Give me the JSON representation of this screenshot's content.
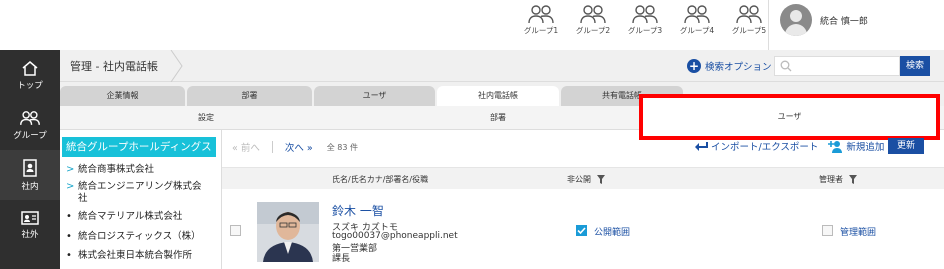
{
  "header": {
    "groups": [
      {
        "label": "グループ1"
      },
      {
        "label": "グループ2"
      },
      {
        "label": "グループ3"
      },
      {
        "label": "グループ4"
      },
      {
        "label": "グループ5"
      }
    ],
    "user_name": "統合 慎一郎"
  },
  "nav": {
    "items": [
      {
        "label": "トップ",
        "icon": "home-icon"
      },
      {
        "label": "グループ",
        "icon": "group-icon"
      },
      {
        "label": "社内",
        "icon": "contacts-book-icon"
      },
      {
        "label": "社外",
        "icon": "id-card-icon"
      }
    ]
  },
  "breadcrumb": "管理 - 社内電話帳",
  "search": {
    "options_label": "検索オプション",
    "placeholder": "",
    "button_label": "検索"
  },
  "tabs": [
    "企業情報",
    "部署",
    "ユーザ",
    "社内電話帳",
    "共有電話帳"
  ],
  "subtabs": [
    "設定",
    "部署",
    "ユーザ"
  ],
  "org": {
    "root": "統合グループホールディングス",
    "items": [
      {
        "label": "統合商事株式会社",
        "type": "arrow"
      },
      {
        "label": "統合エンジニアリング株式会",
        "label2": "社",
        "type": "arrow"
      },
      {
        "label": "統合マテリアル株式会社",
        "type": "dot"
      },
      {
        "label": "統合ロジスティックス（株）",
        "type": "dot"
      },
      {
        "label": "株式会社東日本統合製作所",
        "type": "dot"
      }
    ]
  },
  "pager": {
    "prev": "« 前へ",
    "next": "次へ »",
    "total": "全 83 件"
  },
  "actions": {
    "import_export": "インポート/エクスポート",
    "add_new": "新規追加",
    "update": "更新"
  },
  "table": {
    "col_name": "氏名/氏名カナ/部署名/役職",
    "col_private": "非公開",
    "col_admin": "管理者"
  },
  "row": {
    "name": "鈴木 一智",
    "kana": "スズキ カズトモ",
    "email": "togo00037@phoneappli.net",
    "dept": "第一営業部",
    "title": "課長",
    "public_range": "公開範囲",
    "admin_range": "管理範囲"
  }
}
